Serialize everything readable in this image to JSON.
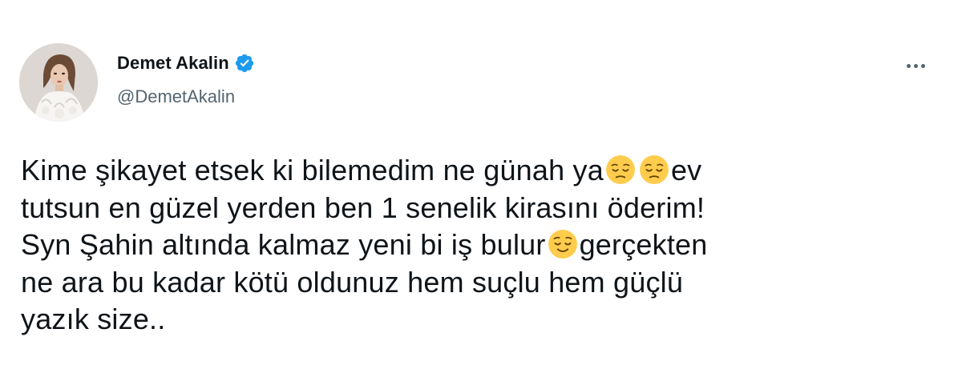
{
  "author": {
    "display_name": "Demet Akalin",
    "handle": "@DemetAkalin",
    "verified": true,
    "verified_icon": "verified-badge-icon",
    "avatar_icon": "profile-photo"
  },
  "menu": {
    "more_icon": "more-horizontal-icon"
  },
  "tweet": {
    "lines": [
      {
        "seg1": "Kime şikayet etsek ki bilemedim ne günah ya",
        "seg2": "ev"
      },
      {
        "seg1": "tutsun en güzel yerden ben 1 senelik kirasını öderim!"
      },
      {
        "seg1": "Syn Şahin altında kalmaz yeni bi iş bulur",
        "seg2": "gerçekten"
      },
      {
        "seg1": "ne ara bu kadar kötü oldunuz hem suçlu hem güçlü"
      },
      {
        "seg1": "yazık size.."
      }
    ],
    "emojis": [
      "pensive-face-emoji",
      "pensive-face-emoji",
      "relieved-face-emoji"
    ]
  },
  "colors": {
    "text": "#0f1419",
    "secondary": "#536471",
    "verified_blue": "#1d9bf0",
    "emoji_yellow": "#ffcc4d"
  }
}
